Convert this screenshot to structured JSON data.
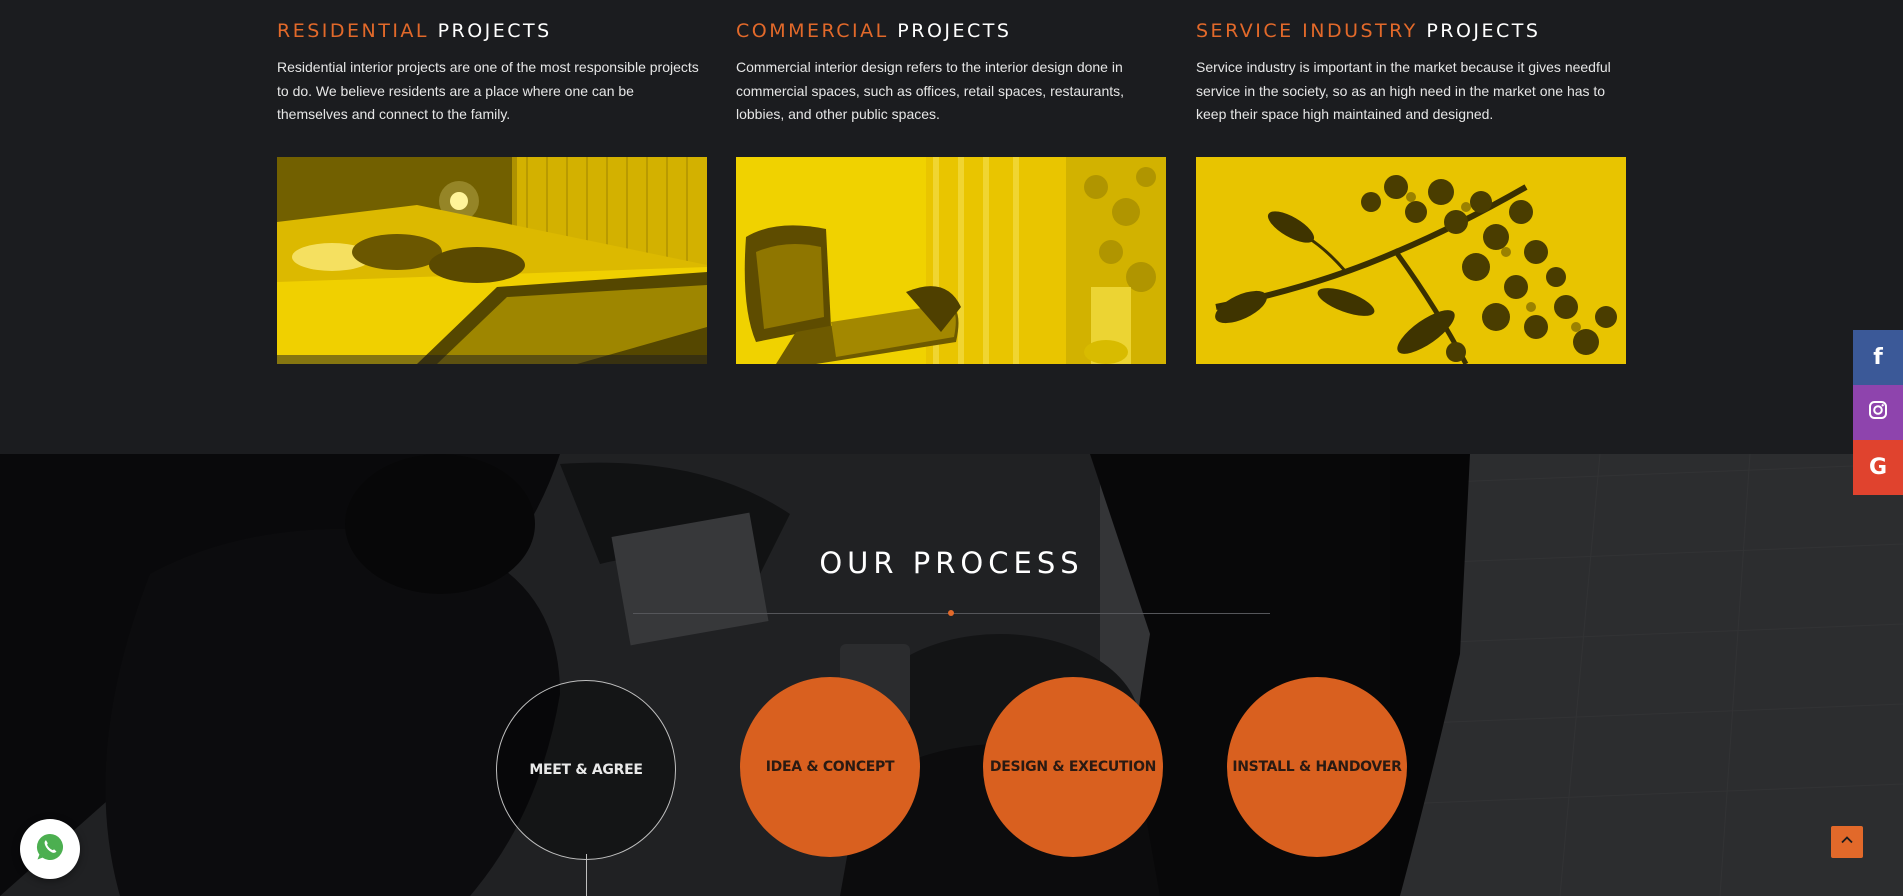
{
  "projects": [
    {
      "title_accent": "RESIDENTIAL",
      "title_rest": "PROJECTS",
      "description": "Residential interior projects are one of the most responsible projects to do. We believe residents are a place where one can be themselves and connect to the family.",
      "image": "bedroom-photo"
    },
    {
      "title_accent": "COMMERCIAL",
      "title_rest": "PROJECTS",
      "description": "Commercial interior design refers to the interior design done in commercial spaces, such as offices, retail spaces, restaurants, lobbies, and other public spaces.",
      "image": "lounge-chair-photo"
    },
    {
      "title_accent": "SERVICE INDUSTRY",
      "title_rest": "PROJECTS",
      "description": "Service industry is important in the market because it gives needful service in the society, so as an high need in the market one has to keep their space high maintained and designed.",
      "image": "flowers-photo"
    }
  ],
  "process": {
    "title": "OUR PROCESS",
    "steps": [
      {
        "label": "MEET & AGREE",
        "style": "outline"
      },
      {
        "label": "IDEA & CONCEPT",
        "style": "filled"
      },
      {
        "label": "DESIGN & EXECUTION",
        "style": "filled"
      },
      {
        "label": "INSTALL & HANDOVER",
        "style": "filled"
      }
    ]
  },
  "social": [
    {
      "name": "facebook",
      "glyph": "f",
      "color": "#3b5998"
    },
    {
      "name": "instagram",
      "glyph": "",
      "color": "#8e44ad"
    },
    {
      "name": "google",
      "glyph": "G",
      "color": "#e0432e"
    }
  ],
  "colors": {
    "accent": "#e2692a",
    "image_tint": "#e9c500",
    "background": "#1b1c1f"
  }
}
